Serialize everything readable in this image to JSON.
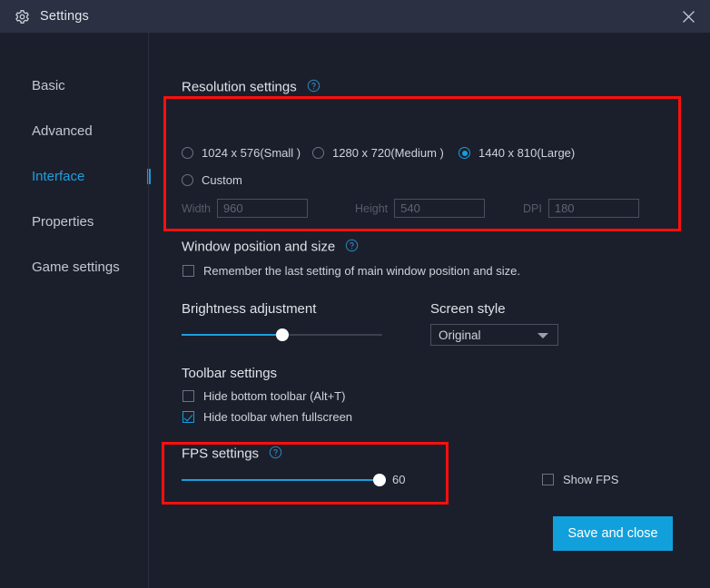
{
  "window": {
    "title": "Settings",
    "gear_icon": "gear-icon",
    "close_icon": "close-icon"
  },
  "sidebar": {
    "items": [
      {
        "label": "Basic",
        "active": false
      },
      {
        "label": "Advanced",
        "active": false
      },
      {
        "label": "Interface",
        "active": true
      },
      {
        "label": "Properties",
        "active": false
      },
      {
        "label": "Game settings",
        "active": false
      }
    ]
  },
  "main": {
    "resolution": {
      "title": "Resolution settings",
      "help_icon": "help-circle-icon",
      "options": [
        {
          "label": "1024 x 576(Small )",
          "selected": false
        },
        {
          "label": "1280 x 720(Medium )",
          "selected": false
        },
        {
          "label": "1440 x 810(Large)",
          "selected": true
        },
        {
          "label": "Custom",
          "selected": false
        }
      ],
      "fields": [
        {
          "label": "Width",
          "value": "960",
          "disabled": true
        },
        {
          "label": "Height",
          "value": "540",
          "disabled": true
        },
        {
          "label": "DPI",
          "value": "180",
          "disabled": true
        }
      ]
    },
    "window_position": {
      "title": "Window position and size",
      "help_icon": "help-circle-icon",
      "checkbox": {
        "label": "Remember the last setting of main window position and size.",
        "checked": false
      }
    },
    "brightness": {
      "title": "Brightness adjustment",
      "percent": 50
    },
    "screen_style": {
      "title": "Screen style",
      "value": "Original",
      "caret_icon": "chevron-down-icon"
    },
    "toolbar": {
      "title": "Toolbar settings",
      "checkboxes": [
        {
          "label": "Hide bottom toolbar (Alt+T)",
          "checked": false
        },
        {
          "label": "Hide toolbar when fullscreen",
          "checked": true
        }
      ]
    },
    "fps": {
      "title": "FPS settings",
      "help_icon": "help-circle-icon",
      "value": "60",
      "percent": 100,
      "show_fps": {
        "label": "Show FPS",
        "checked": false
      }
    },
    "save_button": "Save and close"
  },
  "annotations": [
    {
      "name": "resolution-settings-highlight",
      "color": "#fb0f0f"
    },
    {
      "name": "fps-settings-highlight",
      "color": "#fb0f0f"
    }
  ],
  "colors": {
    "accent": "#139fe0",
    "titlebar": "#2b3142",
    "background": "#1b1f2b",
    "annotation": "#fb0f0f"
  }
}
